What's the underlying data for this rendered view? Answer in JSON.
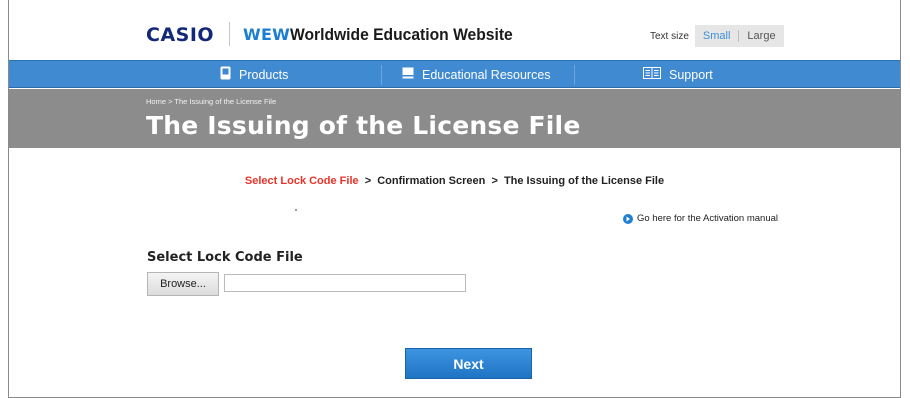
{
  "header": {
    "brand": "CASIO",
    "wew": "WEW",
    "site_title": "Worldwide Education Website",
    "text_size": {
      "label": "Text size",
      "small": "Small",
      "large": "Large"
    }
  },
  "nav": {
    "items": [
      {
        "label": "Products",
        "icon": "device-icon"
      },
      {
        "label": "Educational Resources",
        "icon": "book-icon"
      },
      {
        "label": "Support",
        "icon": "manual-icon"
      }
    ]
  },
  "band": {
    "breadcrumb": "Home > The Issuing of the License File",
    "title": "The Issuing of the License File"
  },
  "steps": {
    "step1": "Select Lock Code File",
    "sep": ">",
    "step2": "Confirmation Screen",
    "step3": "The Issuing of the License File"
  },
  "manual_link": "Go here for the Activation manual",
  "form": {
    "section_title": "Select Lock Code File",
    "browse_label": "Browse...",
    "file_value": ""
  },
  "next_label": "Next",
  "colors": {
    "nav": "#3f8ad0",
    "band": "#8c8c8c",
    "active_step": "#e8332a",
    "brand": "#14287a",
    "accent": "#1a7fd4"
  }
}
